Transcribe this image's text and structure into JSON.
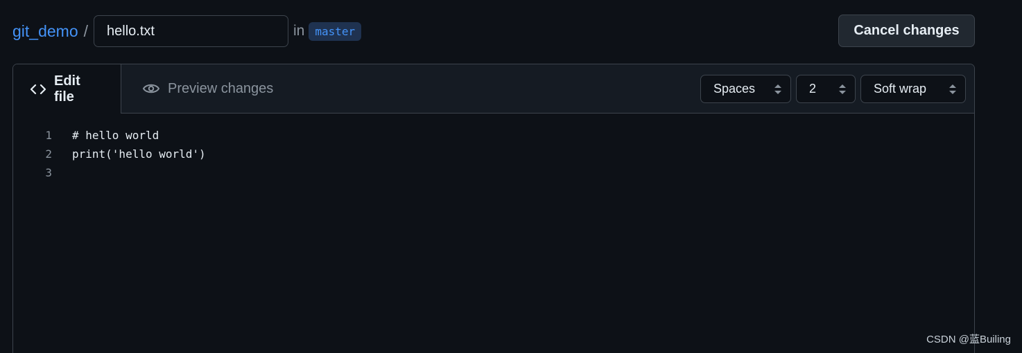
{
  "header": {
    "repo_name": "git_demo",
    "separator": "/",
    "filename_value": "hello.txt",
    "in_label": "in",
    "branch": "master",
    "cancel_label": "Cancel changes"
  },
  "tabs": {
    "edit_label": "Edit file",
    "preview_label": "Preview changes"
  },
  "controls": {
    "indent_mode": "Spaces",
    "indent_size": "2",
    "wrap_mode": "Soft wrap"
  },
  "code": {
    "lines": [
      {
        "number": "1",
        "text": "# hello world"
      },
      {
        "number": "2",
        "text": "print('hello world')"
      },
      {
        "number": "3",
        "text": ""
      }
    ]
  },
  "watermark": "CSDN @蓝Builing",
  "icons": {
    "edit_tab": "code-icon",
    "preview_tab": "eye-icon",
    "select_arrows": "chevron-up-down-icon"
  },
  "colors": {
    "background": "#0d1117",
    "accent": "#4493f8",
    "border": "#3d444d"
  }
}
